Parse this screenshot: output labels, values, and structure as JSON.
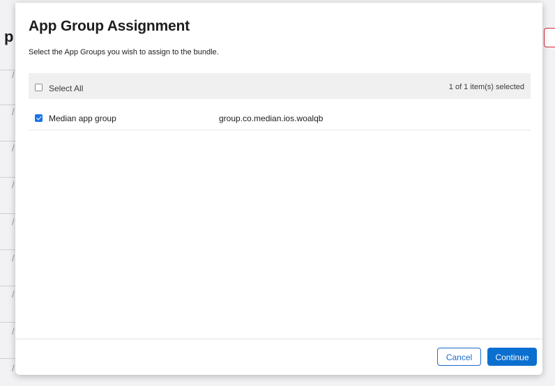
{
  "background": {
    "title_fragment": "p",
    "row_glyph": "/"
  },
  "modal": {
    "title": "App Group Assignment",
    "description": "Select the App Groups you wish to assign to the bundle.",
    "list_header": {
      "select_all_label": "Select All",
      "select_all_checked": false,
      "selected_count": "1 of 1 item(s) selected"
    },
    "items": [
      {
        "name": "Median app group",
        "identifier": "group.co.median.ios.woalqb",
        "checked": true
      }
    ],
    "footer": {
      "cancel_label": "Cancel",
      "continue_label": "Continue"
    }
  },
  "colors": {
    "accent": "#0b6fd0",
    "checkbox_checked": "#1a73e8",
    "background_alert": "#d62a3a"
  }
}
